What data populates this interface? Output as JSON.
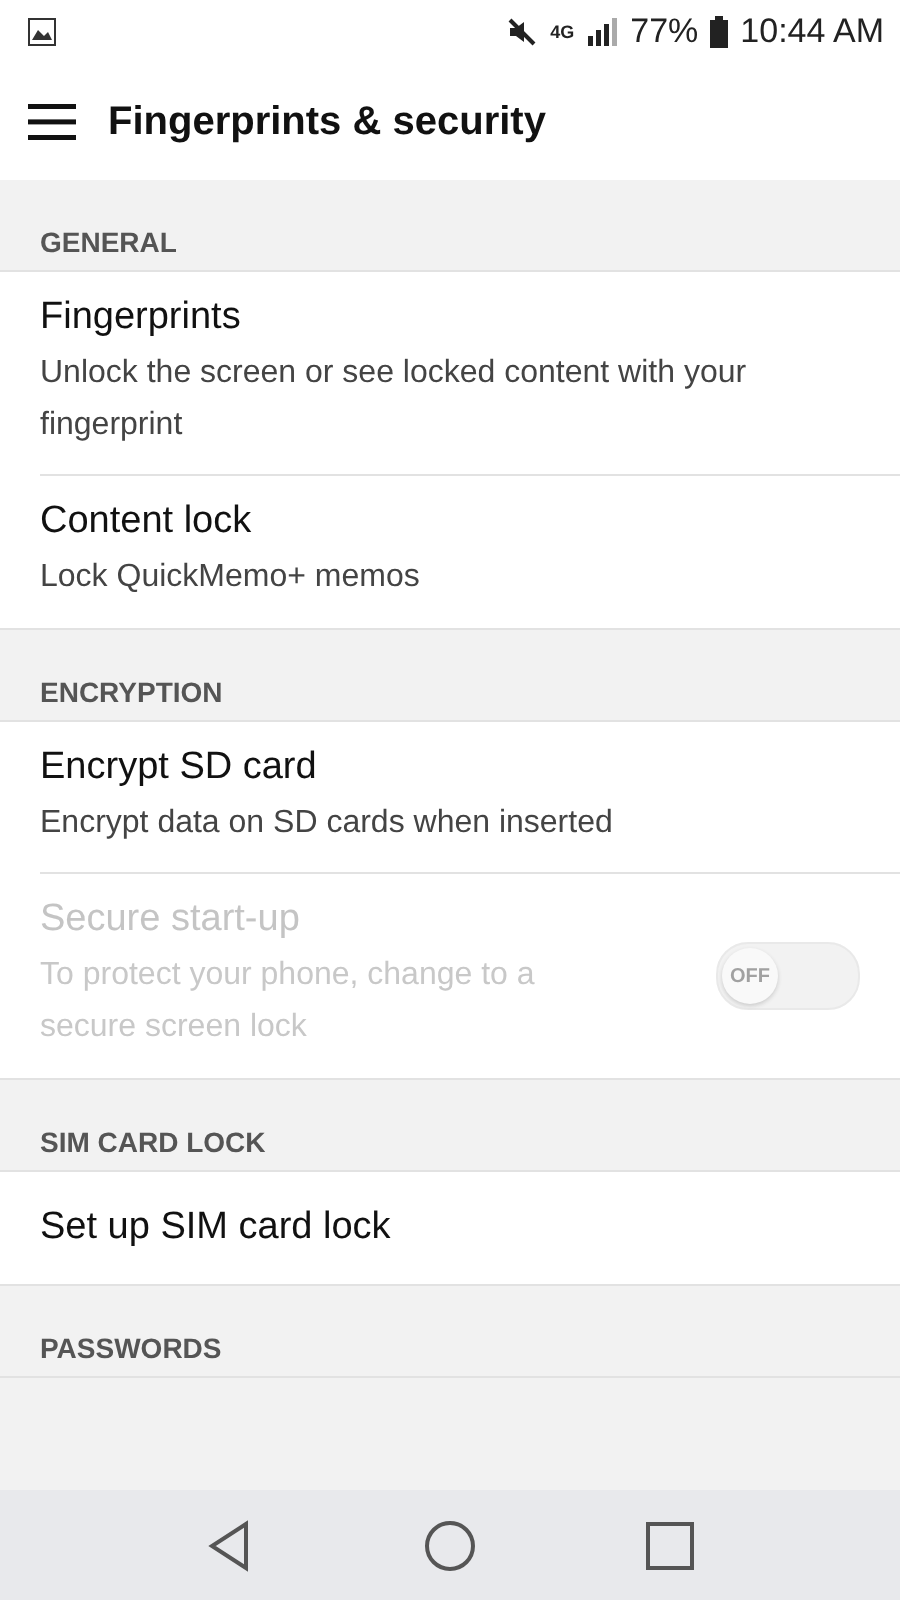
{
  "status_bar": {
    "battery": "77%",
    "time": "10:44 AM",
    "network": "4G"
  },
  "app_bar": {
    "title": "Fingerprints & security"
  },
  "sections": [
    {
      "header": "GENERAL",
      "items": [
        {
          "kind": "plain",
          "title": "Fingerprints",
          "subtitle": "Unlock the screen or see locked content with your fingerprint",
          "disabled": false
        },
        {
          "kind": "plain",
          "title": "Content lock",
          "subtitle": "Lock QuickMemo+ memos",
          "disabled": false
        }
      ]
    },
    {
      "header": "ENCRYPTION",
      "items": [
        {
          "kind": "plain",
          "title": "Encrypt SD card",
          "subtitle": "Encrypt data on SD cards when inserted",
          "disabled": false
        },
        {
          "kind": "toggle",
          "title": "Secure start-up",
          "subtitle": "To protect your phone, change to a secure screen lock",
          "disabled": true,
          "on": false,
          "toggle_label": "OFF"
        }
      ]
    },
    {
      "header": "SIM CARD LOCK",
      "items": [
        {
          "kind": "plain",
          "title": "Set up SIM card lock",
          "disabled": false
        }
      ]
    },
    {
      "header": "PASSWORDS"
    }
  ]
}
